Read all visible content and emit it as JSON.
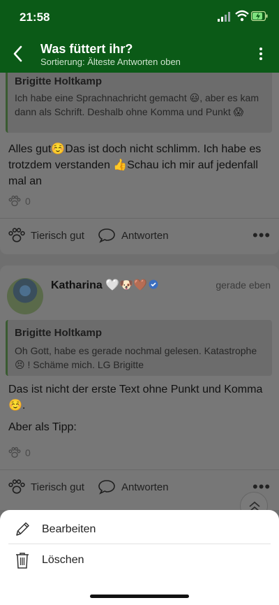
{
  "status_bar": {
    "time": "21:58",
    "accent": "#0b5a17"
  },
  "app_bar": {
    "title": "Was füttert ihr?",
    "subtitle": "Sortierung: Älteste Antworten oben"
  },
  "posts": [
    {
      "quote": {
        "author": "Brigitte Holtkamp",
        "text": "Ich habe eine Sprachnachricht gemacht 😃, aber es kam dann als Schrift. Deshalb ohne Komma und Punkt 😱"
      },
      "body": "Alles gut☺️Das ist doch nicht schlimm. Ich habe es trotzdem verstanden 👍Schau ich mir auf jedenfall mal an",
      "reaction_count": "0",
      "actions": {
        "like": "Tierisch gut",
        "reply": "Antworten"
      }
    },
    {
      "author": {
        "name": "Katharina 🤍🐶🤎",
        "time": "gerade eben"
      },
      "quote": {
        "author": "Brigitte Holtkamp",
        "text": "Oh Gott, habe es gerade nochmal gelesen. Katastrophe 😣 ! Schäme mich. LG Brigitte"
      },
      "body_1": "Das ist nicht der erste Text ohne Punkt und Komma ☺️.",
      "body_2": "Aber als Tipp:",
      "reaction_count": "0",
      "actions": {
        "like": "Tierisch gut",
        "reply": "Antworten"
      }
    }
  ],
  "bottom_sheet": {
    "items": [
      {
        "label": "Bearbeiten",
        "icon": "pencil-icon"
      },
      {
        "label": "Löschen",
        "icon": "trash-icon"
      }
    ]
  }
}
